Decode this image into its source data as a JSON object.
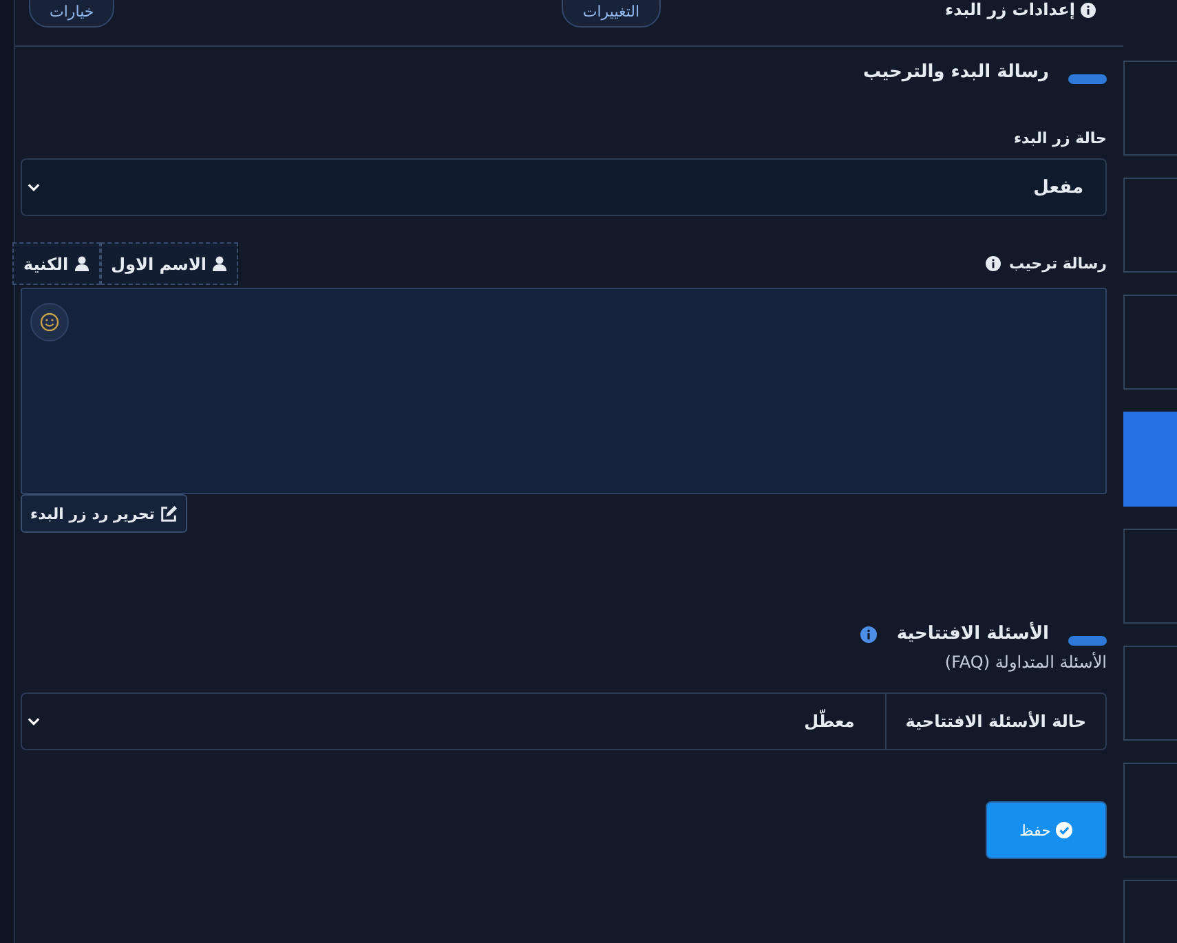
{
  "header": {
    "title": "إعدادات زر البدء",
    "changes_button": "التغييرات",
    "options_button": "خيارات"
  },
  "welcome_section": {
    "title": "رسالة البدء والترحيب",
    "status_label": "حالة زر البدء",
    "status_value": "مفعل",
    "message_label": "رسالة ترحيب",
    "variables": [
      {
        "label": "الاسم الاول"
      },
      {
        "label": "الكنية"
      }
    ],
    "edit_button": "تحرير رد زر البدء"
  },
  "faq_section": {
    "title": "الأسئلة الافتتاحية",
    "subtitle": "الأسئلة المتداولة (FAQ)",
    "status_label": "حالة الأسئلة الافتتاحية",
    "status_value": "معطّل"
  },
  "save_button": "حفظ",
  "side_tiles": [
    {
      "selected": false
    },
    {
      "selected": false
    },
    {
      "selected": false
    },
    {
      "selected": true
    },
    {
      "selected": false
    },
    {
      "selected": false
    },
    {
      "selected": false
    },
    {
      "selected": false
    }
  ]
}
